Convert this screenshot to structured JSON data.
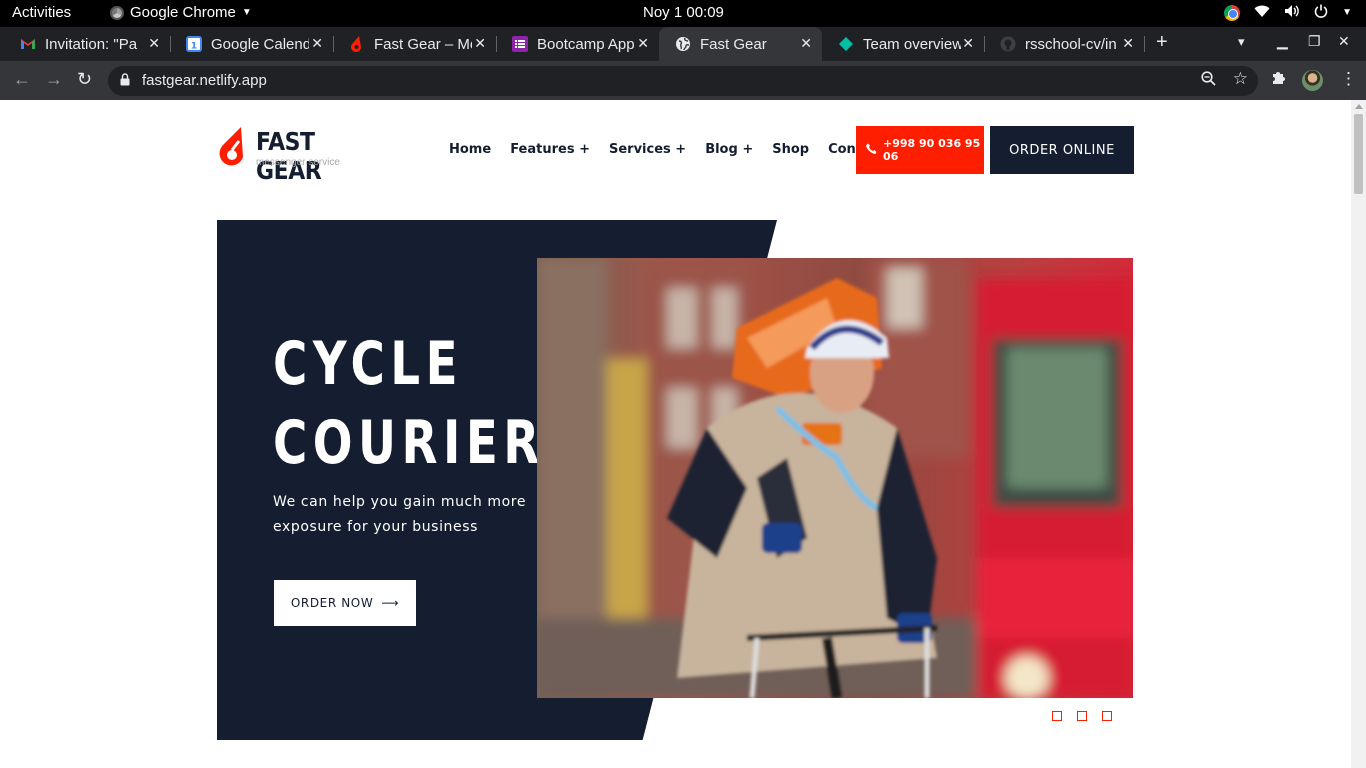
{
  "system": {
    "activities": "Activities",
    "app_menu": "Google Chrome",
    "clock": "Noy 1  00:09"
  },
  "tabs": [
    {
      "title": "Invitation: \"Pa",
      "favicon_color": "#ea4335"
    },
    {
      "title": "Google Calend",
      "favicon_color": "#4285f4"
    },
    {
      "title": "Fast Gear – Me",
      "favicon_color": "#ff1e00"
    },
    {
      "title": "Bootcamp App",
      "favicon_color": "#8e24aa"
    },
    {
      "title": "Fast Gear",
      "favicon_color": "#9aa0a6",
      "active": true
    },
    {
      "title": "Team overview",
      "favicon_color": "#00bfa5"
    },
    {
      "title": "rsschool-cv/in",
      "favicon_color": "#3c4043"
    }
  ],
  "browser": {
    "url": "fastgear.netlify.app"
  },
  "site": {
    "brand": "FAST GEAR",
    "tagline": "messenger service",
    "brand_color": "#ff1e00",
    "dark_color": "#141e30",
    "nav": [
      "Home",
      "Features +",
      "Services +",
      "Blog +",
      "Shop",
      "Contact"
    ],
    "phone": "+998 90 036 95 06",
    "order_online": "ORDER ONLINE"
  },
  "hero": {
    "title_line1": "CYCLE",
    "title_line2": "COURIER",
    "subtitle": "We can help you gain much more exposure for your business",
    "cta": "ORDER NOW",
    "cta_arrow": "⟶",
    "slides": 3
  }
}
